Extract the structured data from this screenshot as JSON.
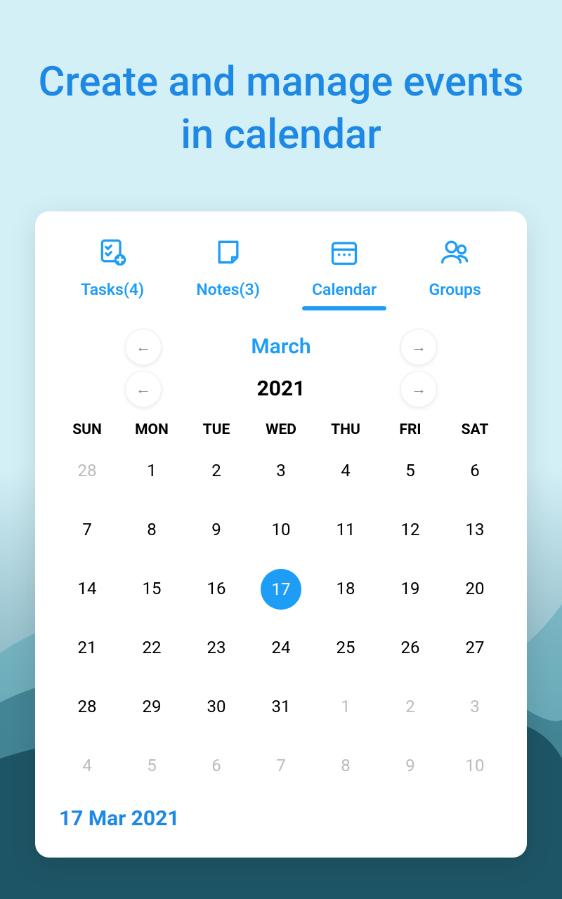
{
  "headline": "Create and manage events in calendar",
  "tabs": [
    {
      "label": "Tasks(4)"
    },
    {
      "label": "Notes(3)"
    },
    {
      "label": "Calendar"
    },
    {
      "label": "Groups"
    }
  ],
  "month": "March",
  "year": "2021",
  "dow": [
    "SUN",
    "MON",
    "TUE",
    "WED",
    "THU",
    "FRI",
    "SAT"
  ],
  "days": [
    {
      "n": "28",
      "muted": true
    },
    {
      "n": "1"
    },
    {
      "n": "2"
    },
    {
      "n": "3"
    },
    {
      "n": "4"
    },
    {
      "n": "5"
    },
    {
      "n": "6"
    },
    {
      "n": "7"
    },
    {
      "n": "8"
    },
    {
      "n": "9"
    },
    {
      "n": "10"
    },
    {
      "n": "11"
    },
    {
      "n": "12"
    },
    {
      "n": "13"
    },
    {
      "n": "14"
    },
    {
      "n": "15"
    },
    {
      "n": "16"
    },
    {
      "n": "17",
      "selected": true
    },
    {
      "n": "18"
    },
    {
      "n": "19"
    },
    {
      "n": "20"
    },
    {
      "n": "21"
    },
    {
      "n": "22"
    },
    {
      "n": "23"
    },
    {
      "n": "24"
    },
    {
      "n": "25"
    },
    {
      "n": "26"
    },
    {
      "n": "27"
    },
    {
      "n": "28"
    },
    {
      "n": "29"
    },
    {
      "n": "30"
    },
    {
      "n": "31"
    },
    {
      "n": "1",
      "muted": true
    },
    {
      "n": "2",
      "muted": true
    },
    {
      "n": "3",
      "muted": true
    },
    {
      "n": "4",
      "muted": true
    },
    {
      "n": "5",
      "muted": true
    },
    {
      "n": "6",
      "muted": true
    },
    {
      "n": "7",
      "muted": true
    },
    {
      "n": "8",
      "muted": true
    },
    {
      "n": "9",
      "muted": true
    },
    {
      "n": "10",
      "muted": true
    }
  ],
  "footer_date": "17 Mar 2021",
  "arrows": {
    "left": "←",
    "right": "→"
  }
}
